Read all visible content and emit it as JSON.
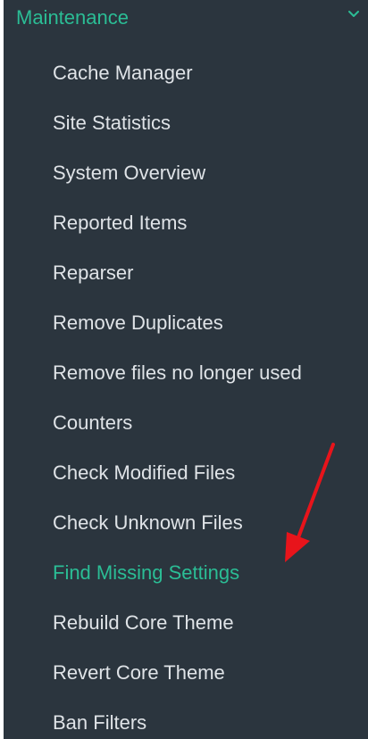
{
  "section": {
    "title": "Maintenance",
    "toggle_icon": "chevron-down-icon"
  },
  "menu": {
    "items": [
      {
        "label": "Cache Manager"
      },
      {
        "label": "Site Statistics"
      },
      {
        "label": "System Overview"
      },
      {
        "label": "Reported Items"
      },
      {
        "label": "Reparser"
      },
      {
        "label": "Remove Duplicates"
      },
      {
        "label": "Remove files no longer used"
      },
      {
        "label": "Counters"
      },
      {
        "label": "Check Modified Files"
      },
      {
        "label": "Check Unknown Files"
      },
      {
        "label": "Find Missing Settings"
      },
      {
        "label": "Rebuild Core Theme"
      },
      {
        "label": "Revert Core Theme"
      },
      {
        "label": "Ban Filters"
      }
    ],
    "active_label": "Find Missing Settings"
  },
  "annotation": {
    "icon": "red-arrow-icon",
    "color": "#e8141b"
  },
  "colors": {
    "panel_background": "#2b353e",
    "accent": "#2bbd95",
    "item_text": "#dfe3e7"
  }
}
